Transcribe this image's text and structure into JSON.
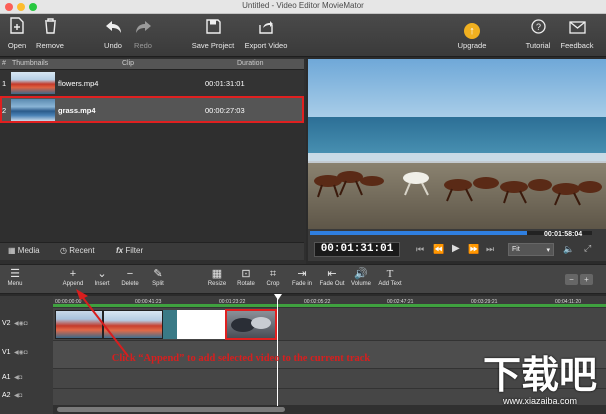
{
  "window": {
    "title": "Untitled - Video Editor MovieMator"
  },
  "toolbar": {
    "open": "Open",
    "remove": "Remove",
    "undo": "Undo",
    "redo": "Redo",
    "save_project": "Save Project",
    "export_video": "Export Video",
    "upgrade": "Upgrade",
    "tutorial": "Tutorial",
    "feedback": "Feedback"
  },
  "clip_list": {
    "headers": {
      "num": "#",
      "thumbnails": "Thumbnails",
      "clip": "Clip",
      "duration": "Duration"
    },
    "rows": [
      {
        "num": "1",
        "clip": "flowers.mp4",
        "duration": "00:01:31:01"
      },
      {
        "num": "2",
        "clip": "grass.mp4",
        "duration": "00:00:27:03"
      }
    ]
  },
  "tabs": {
    "media": "Media",
    "recent": "Recent",
    "filter": "Filter"
  },
  "player": {
    "current_time": "00:01:31:01",
    "total_time": "00:01:58:04",
    "zoom": "Fit",
    "progress": 0.77
  },
  "timeline_toolbar": {
    "menu": "Menu",
    "append": "Append",
    "insert": "Insert",
    "delete": "Delete",
    "split": "Split",
    "resize": "Resize",
    "rotate": "Rotate",
    "crop": "Crop",
    "fade_in": "Fade in",
    "fade_out": "Fade Out",
    "volume": "Volume",
    "add_text": "Add Text"
  },
  "ruler": [
    "00:00:00:00",
    "00:00:41:23",
    "00:01:23:22",
    "00:02:05:22",
    "00:02:47:21",
    "00:03:29:21",
    "00:04:11:20"
  ],
  "tracks": [
    "V2",
    "V1",
    "A1",
    "A2"
  ],
  "annotation": "Click “Append” to add selected video to the current track",
  "watermark": {
    "text": "下载吧",
    "url": "www.xiazaiba.com"
  }
}
